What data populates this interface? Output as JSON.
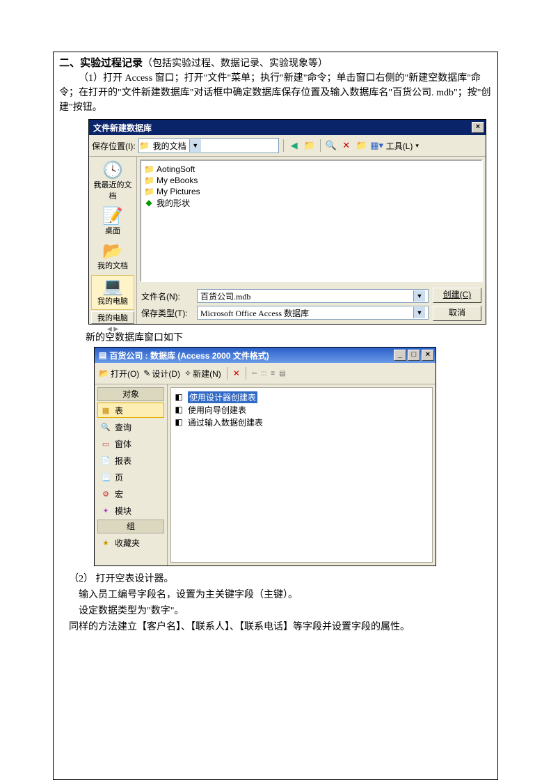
{
  "doc": {
    "heading": "二、实验过程记录",
    "heading_note": "（包括实验过程、数据记录、实验现象等）",
    "p1": "（1）打开 Access 窗口；打开\"文件\"菜单；执行\"新建\"命令；单击窗口右侧的\"新建空数据库\"命令；在打开的\"文件新建数据库\"对话框中确定数据库保存位置及输入数据库名\"百货公司. mdb\"；按\"创建\"按钮。",
    "caption1": "新的空数据库窗口如下",
    "p2": "（2） 打开空表设计器。",
    "p3": "输入员工编号字段名，设置为主关键字段（主键）。",
    "p4": "设定数据类型为\"数字\"。",
    "p5": "同样的方法建立【客户名】、【联系人】、【联系电话】等字段并设置字段的属性。"
  },
  "dlg1": {
    "title": "文件新建数据库",
    "save_in_label": "保存位置(I):",
    "save_in_value": "我的文档",
    "tools": "工具(L)",
    "files": [
      {
        "icon": "📁",
        "name": "AotingSoft"
      },
      {
        "icon": "📁",
        "name": "My eBooks"
      },
      {
        "icon": "📁",
        "name": "My Pictures"
      },
      {
        "icon": "🟩",
        "name": "我的形状"
      }
    ],
    "places": [
      {
        "icon": "🕓",
        "label": "我最近的文档"
      },
      {
        "icon": "🖥",
        "label": "桌面"
      },
      {
        "icon": "📂",
        "label": "我的文档"
      },
      {
        "icon": "💻",
        "label": "我的电脑",
        "sel": true
      },
      {
        "label": "我的电脑",
        "btn": true
      }
    ],
    "filename_label": "文件名(N):",
    "filename_value": "百货公司.mdb",
    "filetype_label": "保存类型(T):",
    "filetype_value": "Microsoft Office Access 数据库",
    "create": "创建(C)",
    "cancel": "取消"
  },
  "dlg2": {
    "title": "百货公司 : 数据库 (Access 2000 文件格式)",
    "tb": {
      "open": "打开(O)",
      "design": "设计(D)",
      "new": "新建(N)"
    },
    "nav": {
      "hdr1": "对象",
      "items": [
        {
          "icon": "▦",
          "label": "表",
          "sel": true
        },
        {
          "icon": "🔍",
          "label": "查询"
        },
        {
          "icon": "🗔",
          "label": "窗体"
        },
        {
          "icon": "📄",
          "label": "报表"
        },
        {
          "icon": "📃",
          "label": "页"
        },
        {
          "icon": "⚙",
          "label": "宏"
        },
        {
          "icon": "✦",
          "label": "模块"
        }
      ],
      "hdr2": "组",
      "fav": {
        "icon": "⭐",
        "label": "收藏夹"
      }
    },
    "list": [
      {
        "icon": "◧",
        "label": "使用设计器创建表",
        "sel": true
      },
      {
        "icon": "◧",
        "label": "使用向导创建表"
      },
      {
        "icon": "◧",
        "label": "通过输入数据创建表"
      }
    ]
  }
}
